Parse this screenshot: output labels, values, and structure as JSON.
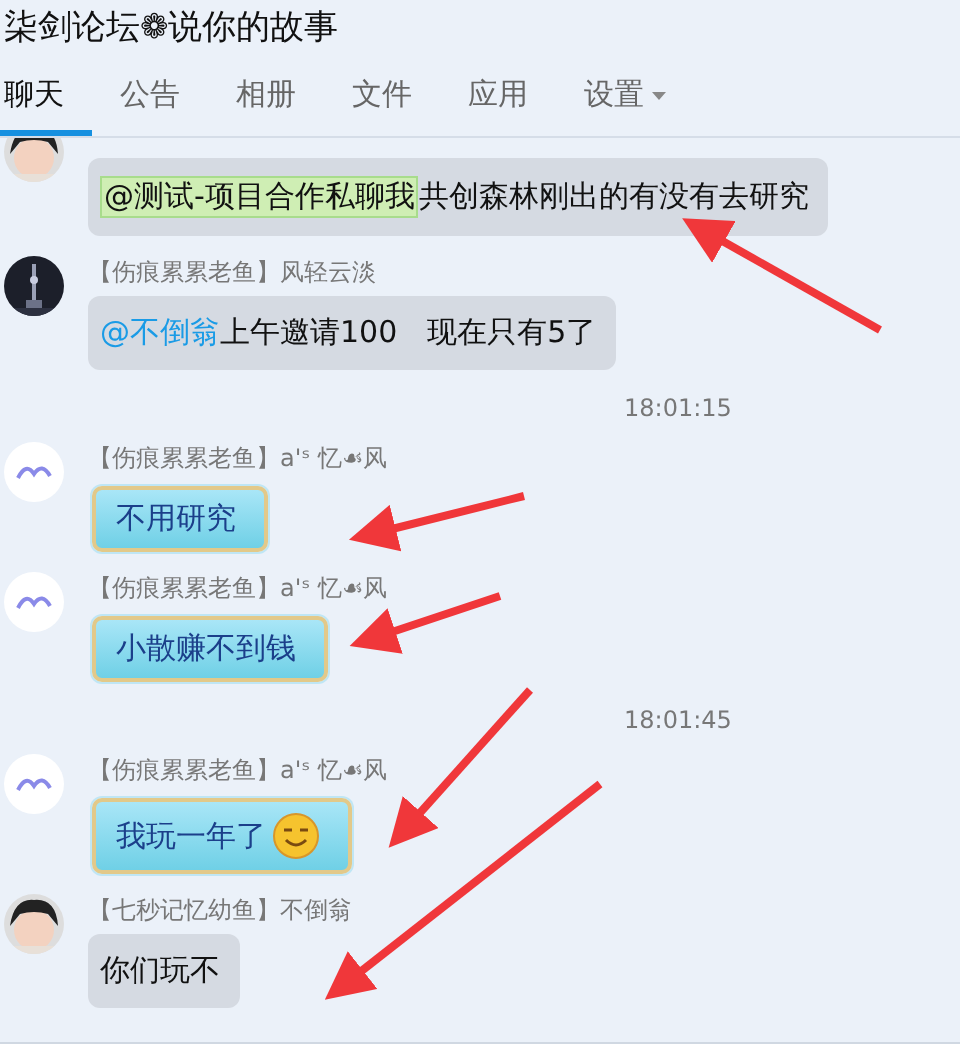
{
  "window": {
    "title": "柒剑论坛❁说你的故事"
  },
  "tabs": [
    {
      "label": "聊天",
      "selected": true
    },
    {
      "label": "公告",
      "selected": false
    },
    {
      "label": "相册",
      "selected": false
    },
    {
      "label": "文件",
      "selected": false
    },
    {
      "label": "应用",
      "selected": false
    },
    {
      "label": "设置",
      "selected": false,
      "dropdown": true
    }
  ],
  "messages": [
    {
      "kind": "plain-message",
      "parts": [
        {
          "kind": "tag",
          "text": "@测试-项目合作私聊我"
        },
        {
          "kind": "plain",
          "text": " 共创森林刚出的有没有去研究"
        }
      ]
    },
    {
      "kind": "plain-message",
      "sender": "【伤痕累累老鱼】风轻云淡",
      "parts": [
        {
          "kind": "link",
          "text": "@不倒翁"
        },
        {
          "kind": "plain",
          "text": " 上午邀请100　现在只有5了"
        }
      ]
    },
    {
      "kind": "time",
      "text": "18:01:15"
    },
    {
      "kind": "fancy-message",
      "sender": "【伤痕累累老鱼】a'ˢ 忆☙风",
      "parts": [
        {
          "kind": "plain",
          "text": "不用研究"
        }
      ]
    },
    {
      "kind": "fancy-message",
      "sender": "【伤痕累累老鱼】a'ˢ 忆☙风",
      "parts": [
        {
          "kind": "plain",
          "text": "小散赚不到钱"
        }
      ]
    },
    {
      "kind": "time",
      "text": "18:01:45"
    },
    {
      "kind": "fancy-message",
      "sender": "【伤痕累累老鱼】a'ˢ 忆☙风",
      "emoji": true,
      "parts": [
        {
          "kind": "plain",
          "text": "我玩一年了"
        }
      ]
    },
    {
      "kind": "plain-message",
      "sender": "【七秒记忆幼鱼】不倒翁",
      "parts": [
        {
          "kind": "plain",
          "text": "你们玩不"
        }
      ]
    }
  ],
  "annotations": [
    {
      "kind": "arrow"
    },
    {
      "kind": "arrow"
    },
    {
      "kind": "arrow"
    },
    {
      "kind": "arrow"
    },
    {
      "kind": "arrow"
    }
  ]
}
